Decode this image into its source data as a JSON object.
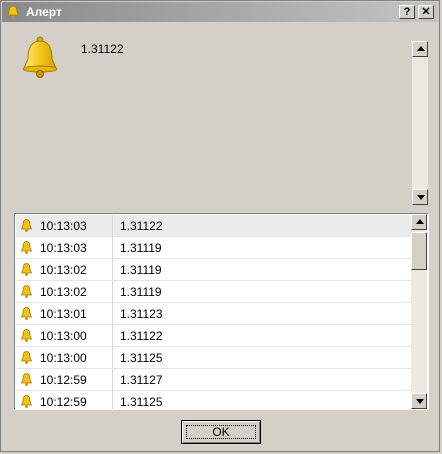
{
  "window": {
    "title": "Алерт",
    "help_label": "?",
    "close_label": "✕",
    "title_icon": "bell-icon"
  },
  "alert": {
    "icon": "bell-icon",
    "message": "1.31122"
  },
  "history": {
    "rows": [
      {
        "time": "10:13:03",
        "value": "1.31122",
        "icon": "bell-icon",
        "selected": true
      },
      {
        "time": "10:13:03",
        "value": "1.31119",
        "icon": "bell-icon"
      },
      {
        "time": "10:13:02",
        "value": "1.31119",
        "icon": "bell-icon"
      },
      {
        "time": "10:13:02",
        "value": "1.31119",
        "icon": "bell-icon"
      },
      {
        "time": "10:13:01",
        "value": "1.31123",
        "icon": "bell-icon"
      },
      {
        "time": "10:13:00",
        "value": "1.31122",
        "icon": "bell-icon"
      },
      {
        "time": "10:13:00",
        "value": "1.31125",
        "icon": "bell-icon"
      },
      {
        "time": "10:12:59",
        "value": "1.31127",
        "icon": "bell-icon"
      },
      {
        "time": "10:12:59",
        "value": "1.31125",
        "icon": "bell-icon"
      }
    ]
  },
  "buttons": {
    "ok_label": "OK"
  },
  "colors": {
    "dialog_bg": "#d4d0c8",
    "bell": "#f2c21a",
    "titlebar": "#8a8a8a"
  }
}
